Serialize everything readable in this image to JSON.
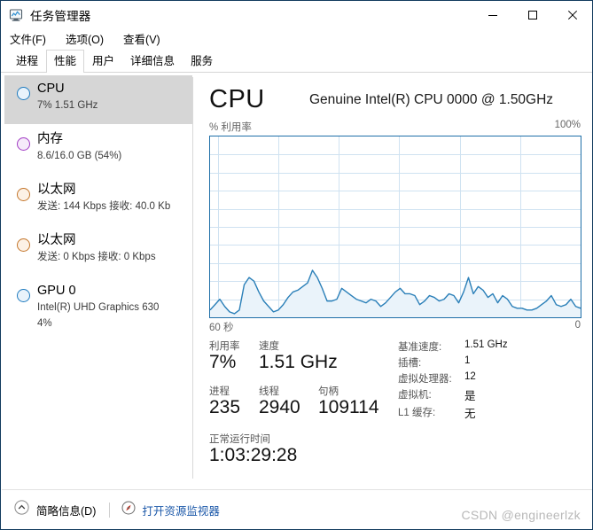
{
  "window": {
    "title": "任务管理器",
    "icon": "task-manager-icon",
    "caption": {
      "minimize": "minimize-icon",
      "maximize": "maximize-icon",
      "close": "close-icon"
    }
  },
  "menubar": {
    "items": [
      {
        "label": "文件(F)"
      },
      {
        "label": "选项(O)"
      },
      {
        "label": "查看(V)"
      }
    ]
  },
  "tabs": [
    {
      "label": "进程",
      "active": false
    },
    {
      "label": "性能",
      "active": true
    },
    {
      "label": "用户",
      "active": false
    },
    {
      "label": "详细信息",
      "active": false
    },
    {
      "label": "服务",
      "active": false
    }
  ],
  "sidebar": {
    "items": [
      {
        "name": "CPU",
        "title": "CPU",
        "sub": "7% 1.51 GHz",
        "sub2": "",
        "color": "#1f7bbf",
        "fill": "#e9f3fb",
        "selected": true
      },
      {
        "name": "内存",
        "title": "内存",
        "sub": "8.6/16.0 GB (54%)",
        "sub2": "",
        "color": "#a13bc4",
        "fill": "#f6ebfa",
        "selected": false
      },
      {
        "name": "以太网",
        "title": "以太网",
        "sub": "发送: 144 Kbps 接收: 40.0 Kb",
        "sub2": "",
        "color": "#c4762b",
        "fill": "#fcf1e6",
        "selected": false
      },
      {
        "name": "以太网",
        "title": "以太网",
        "sub": "发送: 0 Kbps 接收: 0 Kbps",
        "sub2": "",
        "color": "#c4762b",
        "fill": "#fcf1e6",
        "selected": false
      },
      {
        "name": "GPU 0",
        "title": "GPU 0",
        "sub": "Intel(R) UHD Graphics 630",
        "sub2": "4%",
        "color": "#1f7bbf",
        "fill": "#e9f3fb",
        "selected": false
      }
    ]
  },
  "main": {
    "heading": "CPU",
    "model": "Genuine Intel(R) CPU 0000 @ 1.50GHz",
    "chart_axis_label": "% 利用率",
    "chart_axis_max": "100%",
    "chart_foot_left": "60 秒",
    "chart_foot_right": "0",
    "stats": [
      {
        "label": "利用率",
        "value": "7%"
      },
      {
        "label": "速度",
        "value": "1.51 GHz"
      },
      {
        "label": "进程",
        "value": "235"
      },
      {
        "label": "线程",
        "value": "2940"
      },
      {
        "label": "句柄",
        "value": "109114"
      }
    ],
    "uptime": {
      "label": "正常运行时间",
      "value": "1:03:29:28"
    },
    "info": [
      {
        "label": "基准速度:",
        "value": "1.51 GHz"
      },
      {
        "label": "插槽:",
        "value": "1"
      },
      {
        "label": "虚拟处理器:",
        "value": "12"
      },
      {
        "label": "虚拟机:",
        "value": "是"
      },
      {
        "label": "L1 缓存:",
        "value": "无"
      }
    ]
  },
  "footer": {
    "fewer_details_icon": "chevron-up-circle-icon",
    "fewer_details_label": "简略信息(D)",
    "resource_monitor_icon": "resource-monitor-icon",
    "resource_monitor_label": "打开资源监视器"
  },
  "watermark": "CSDN @engineerlzk",
  "chart_data": {
    "type": "area",
    "title": "CPU 利用率",
    "xlabel": "60 秒",
    "ylabel": "% 利用率",
    "ylim": [
      0,
      100
    ],
    "xlim": [
      60,
      0
    ],
    "grid": true,
    "line_color": "#2a7fb8",
    "fill_color": "#eaf3fa",
    "x_ticks": [
      "60 秒",
      "0"
    ],
    "y_ticks": [
      "100%"
    ],
    "values": [
      4,
      7,
      10,
      6,
      3,
      2,
      4,
      18,
      22,
      20,
      14,
      9,
      6,
      3,
      4,
      7,
      11,
      14,
      15,
      17,
      19,
      26,
      22,
      16,
      9,
      9,
      10,
      16,
      14,
      12,
      10,
      9,
      8,
      10,
      9,
      6,
      8,
      11,
      14,
      16,
      13,
      13,
      12,
      7,
      9,
      12,
      11,
      9,
      10,
      13,
      12,
      8,
      14,
      22,
      13,
      17,
      15,
      11,
      13,
      8,
      12,
      10,
      6,
      5,
      5,
      4,
      4,
      5,
      7,
      9,
      12,
      7,
      6,
      7,
      10,
      6,
      5
    ]
  }
}
